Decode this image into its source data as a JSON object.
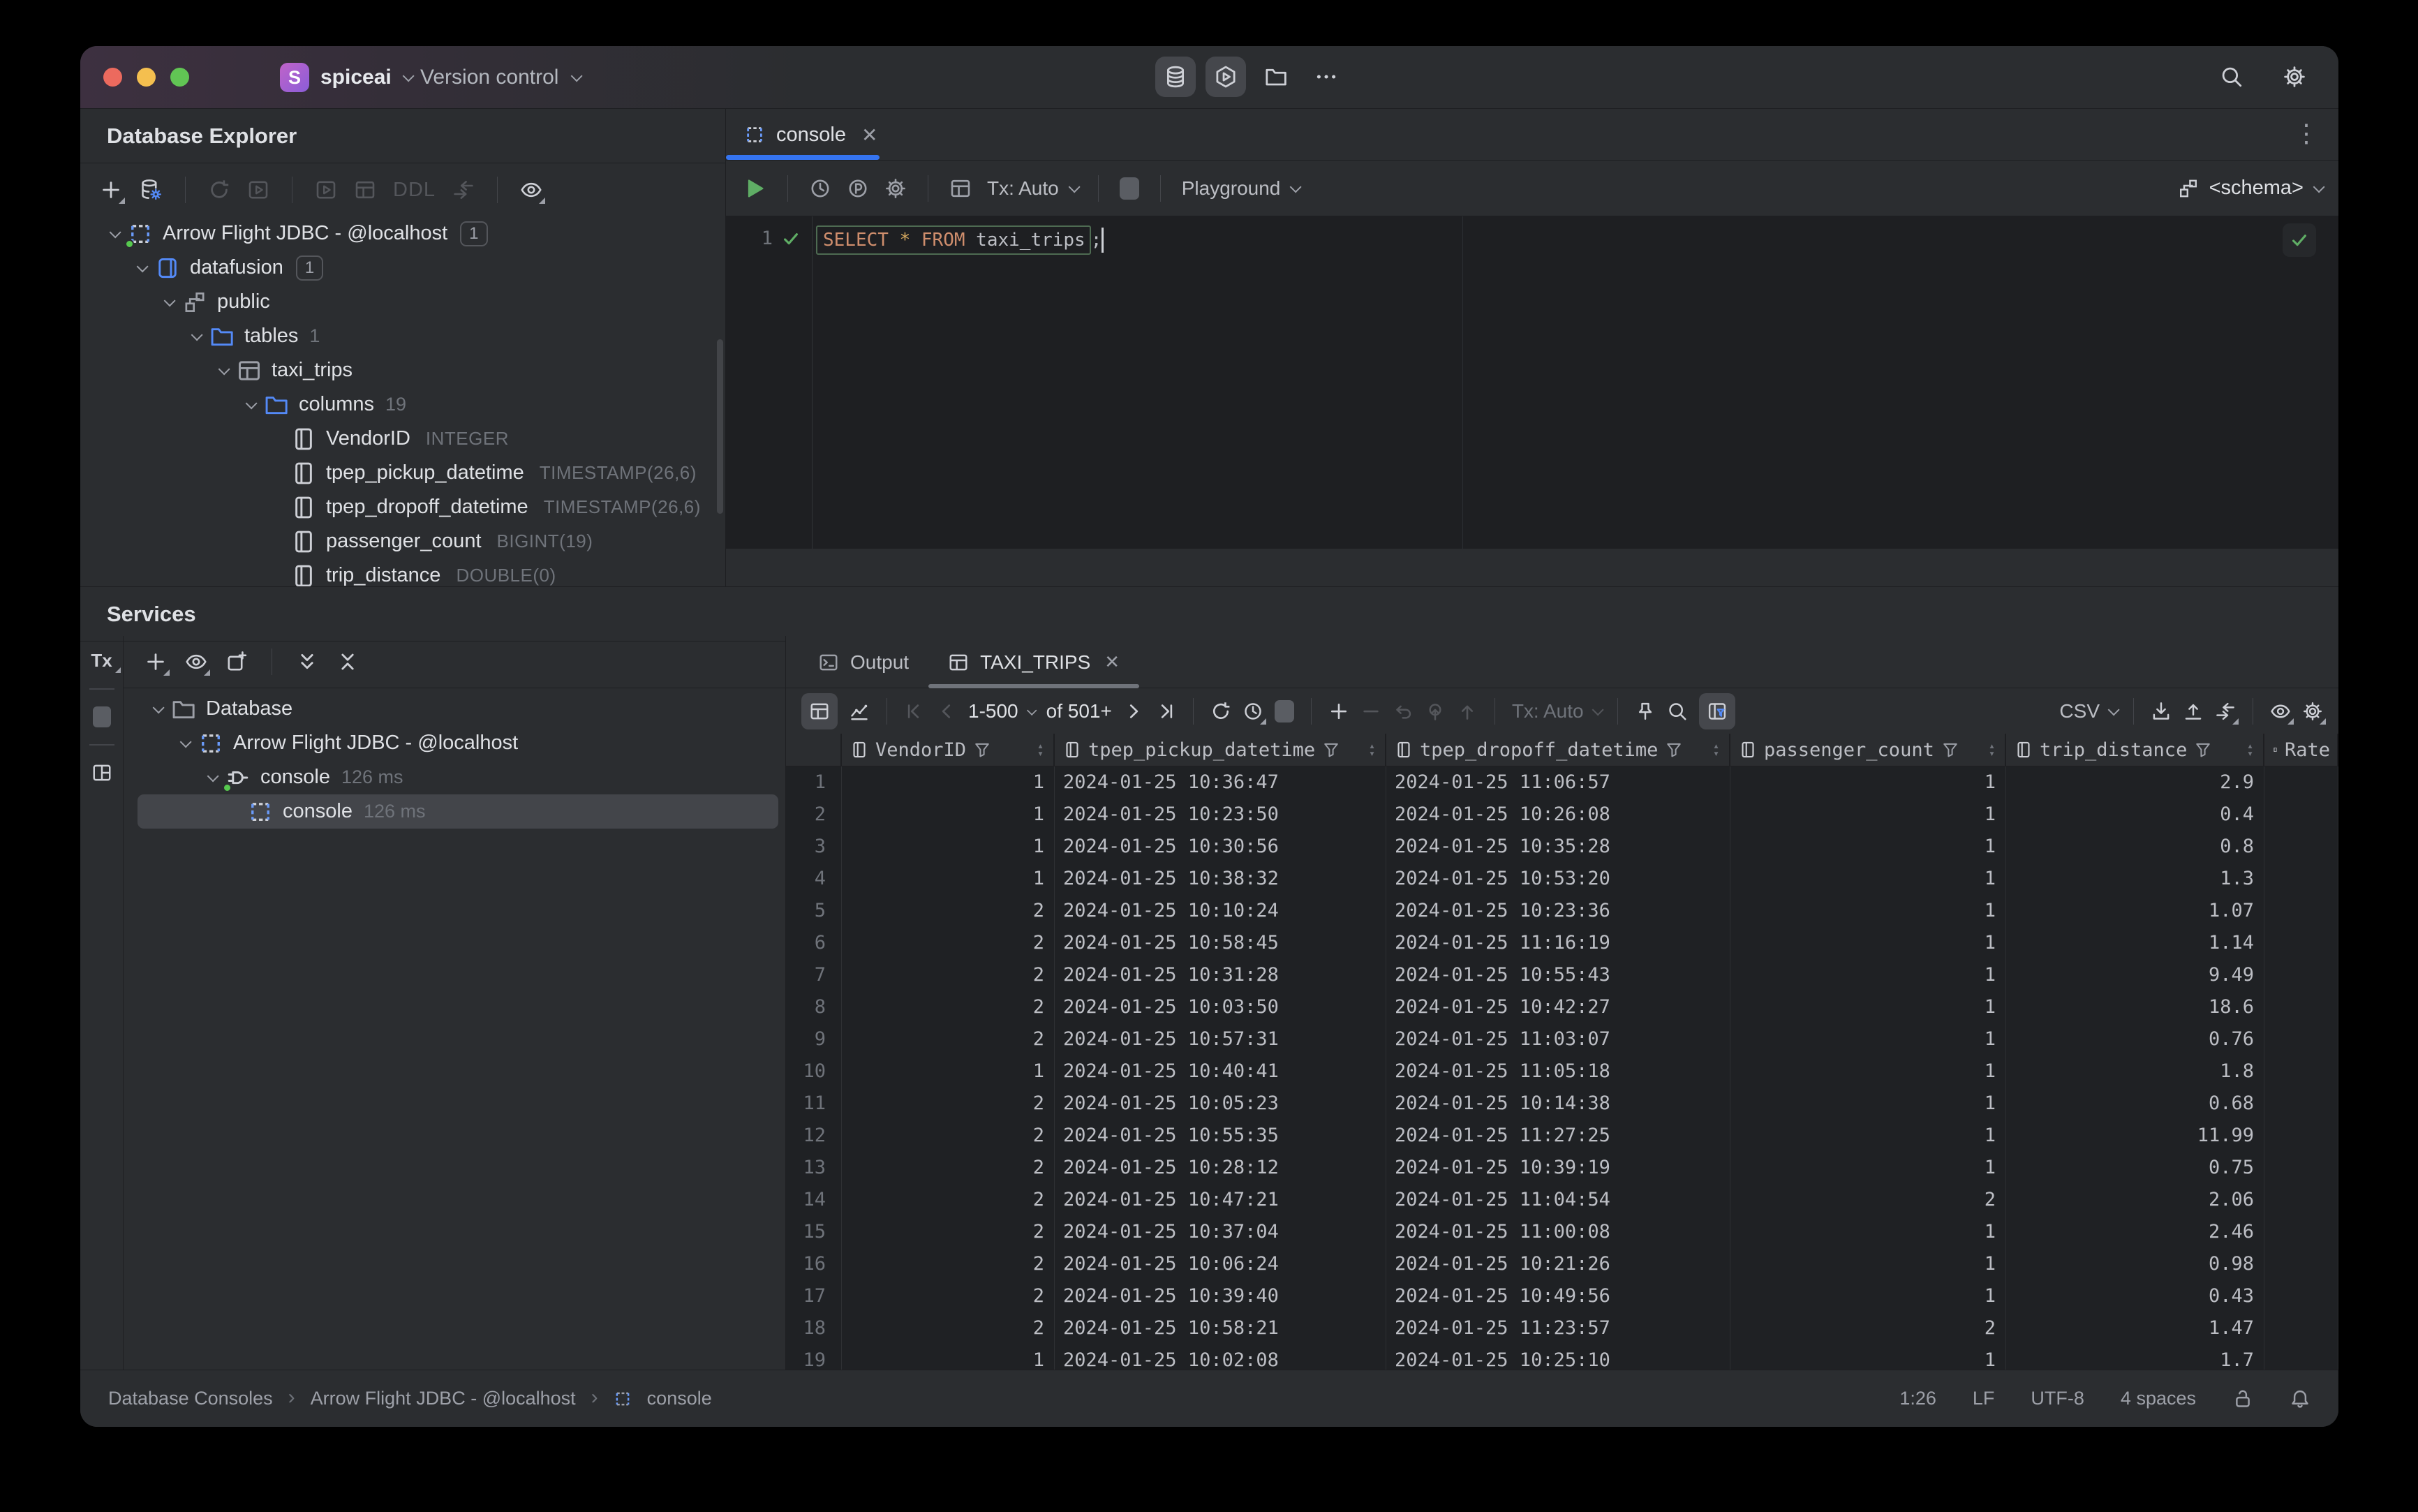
{
  "titlebar": {
    "project": "spiceai",
    "project_initial": "S",
    "menu": "Version control"
  },
  "explorer": {
    "title": "Database Explorer",
    "ddl_label": "DDL",
    "tree": [
      {
        "label": "Arrow Flight JDBC - @localhost",
        "badge": "1"
      },
      {
        "label": "datafusion",
        "badge": "1"
      },
      {
        "label": "public"
      },
      {
        "label": "tables",
        "count": "1"
      },
      {
        "label": "taxi_trips"
      },
      {
        "label": "columns",
        "count": "19"
      },
      {
        "label": "VendorID",
        "type": "INTEGER"
      },
      {
        "label": "tpep_pickup_datetime",
        "type": "TIMESTAMP(26,6)"
      },
      {
        "label": "tpep_dropoff_datetime",
        "type": "TIMESTAMP(26,6)"
      },
      {
        "label": "passenger_count",
        "type": "BIGINT(19)"
      },
      {
        "label": "trip_distance",
        "type": "DOUBLE(0)"
      }
    ]
  },
  "editor": {
    "tab": "console",
    "line_number": "1",
    "sql_select": "SELECT",
    "sql_star": "*",
    "sql_from": "FROM",
    "sql_table": "taxi_trips",
    "sql_semicolon": ";",
    "tx_label": "Tx: Auto",
    "playground_label": "Playground",
    "schema_label": "<schema>"
  },
  "services": {
    "title": "Services",
    "tx_label": "Tx",
    "tree": [
      {
        "label": "Database"
      },
      {
        "label": "Arrow Flight JDBC - @localhost"
      },
      {
        "label": "console",
        "time": "126 ms"
      },
      {
        "label": "console",
        "time": "126 ms"
      }
    ]
  },
  "results": {
    "tab_output": "Output",
    "tab_grid": "TAXI_TRIPS",
    "page_range": "1-500",
    "page_total": "of 501+",
    "tx_label": "Tx: Auto",
    "export_format": "CSV"
  },
  "grid": {
    "columns": [
      "VendorID",
      "tpep_pickup_datetime",
      "tpep_dropoff_datetime",
      "passenger_count",
      "trip_distance",
      "Rate"
    ],
    "rows": [
      {
        "num": "1",
        "vendor": "1",
        "pickup": "2024-01-25 10:36:47",
        "dropoff": "2024-01-25 11:06:57",
        "passengers": "1",
        "distance": "2.9"
      },
      {
        "num": "2",
        "vendor": "1",
        "pickup": "2024-01-25 10:23:50",
        "dropoff": "2024-01-25 10:26:08",
        "passengers": "1",
        "distance": "0.4"
      },
      {
        "num": "3",
        "vendor": "1",
        "pickup": "2024-01-25 10:30:56",
        "dropoff": "2024-01-25 10:35:28",
        "passengers": "1",
        "distance": "0.8"
      },
      {
        "num": "4",
        "vendor": "1",
        "pickup": "2024-01-25 10:38:32",
        "dropoff": "2024-01-25 10:53:20",
        "passengers": "1",
        "distance": "1.3"
      },
      {
        "num": "5",
        "vendor": "2",
        "pickup": "2024-01-25 10:10:24",
        "dropoff": "2024-01-25 10:23:36",
        "passengers": "1",
        "distance": "1.07"
      },
      {
        "num": "6",
        "vendor": "2",
        "pickup": "2024-01-25 10:58:45",
        "dropoff": "2024-01-25 11:16:19",
        "passengers": "1",
        "distance": "1.14"
      },
      {
        "num": "7",
        "vendor": "2",
        "pickup": "2024-01-25 10:31:28",
        "dropoff": "2024-01-25 10:55:43",
        "passengers": "1",
        "distance": "9.49"
      },
      {
        "num": "8",
        "vendor": "2",
        "pickup": "2024-01-25 10:03:50",
        "dropoff": "2024-01-25 10:42:27",
        "passengers": "1",
        "distance": "18.6"
      },
      {
        "num": "9",
        "vendor": "2",
        "pickup": "2024-01-25 10:57:31",
        "dropoff": "2024-01-25 11:03:07",
        "passengers": "1",
        "distance": "0.76"
      },
      {
        "num": "10",
        "vendor": "1",
        "pickup": "2024-01-25 10:40:41",
        "dropoff": "2024-01-25 11:05:18",
        "passengers": "1",
        "distance": "1.8"
      },
      {
        "num": "11",
        "vendor": "2",
        "pickup": "2024-01-25 10:05:23",
        "dropoff": "2024-01-25 10:14:38",
        "passengers": "1",
        "distance": "0.68"
      },
      {
        "num": "12",
        "vendor": "2",
        "pickup": "2024-01-25 10:55:35",
        "dropoff": "2024-01-25 11:27:25",
        "passengers": "1",
        "distance": "11.99"
      },
      {
        "num": "13",
        "vendor": "2",
        "pickup": "2024-01-25 10:28:12",
        "dropoff": "2024-01-25 10:39:19",
        "passengers": "1",
        "distance": "0.75"
      },
      {
        "num": "14",
        "vendor": "2",
        "pickup": "2024-01-25 10:47:21",
        "dropoff": "2024-01-25 11:04:54",
        "passengers": "2",
        "distance": "2.06"
      },
      {
        "num": "15",
        "vendor": "2",
        "pickup": "2024-01-25 10:37:04",
        "dropoff": "2024-01-25 11:00:08",
        "passengers": "1",
        "distance": "2.46"
      },
      {
        "num": "16",
        "vendor": "2",
        "pickup": "2024-01-25 10:06:24",
        "dropoff": "2024-01-25 10:21:26",
        "passengers": "1",
        "distance": "0.98"
      },
      {
        "num": "17",
        "vendor": "2",
        "pickup": "2024-01-25 10:39:40",
        "dropoff": "2024-01-25 10:49:56",
        "passengers": "1",
        "distance": "0.43"
      },
      {
        "num": "18",
        "vendor": "2",
        "pickup": "2024-01-25 10:58:21",
        "dropoff": "2024-01-25 11:23:57",
        "passengers": "2",
        "distance": "1.47"
      },
      {
        "num": "19",
        "vendor": "1",
        "pickup": "2024-01-25 10:02:08",
        "dropoff": "2024-01-25 10:25:10",
        "passengers": "1",
        "distance": "1.7"
      }
    ]
  },
  "statusbar": {
    "crumb1": "Database Consoles",
    "crumb2": "Arrow Flight JDBC - @localhost",
    "crumb3": "console",
    "caret": "1:26",
    "line_sep": "LF",
    "encoding": "UTF-8",
    "indent": "4 spaces"
  },
  "colors": {
    "accent_blue": "#3574f0",
    "icon_blue": "#548af7",
    "run_green": "#5fad65",
    "keyword_orange": "#cf8e6d"
  }
}
